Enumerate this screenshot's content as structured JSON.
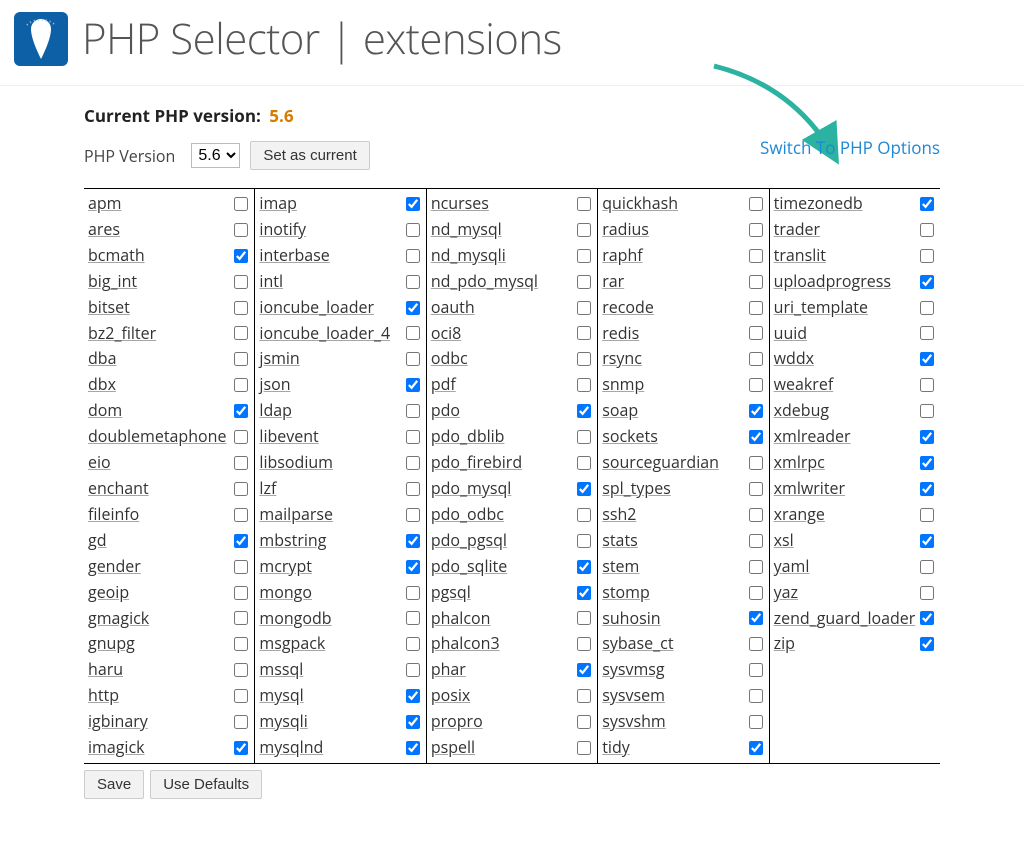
{
  "header": {
    "title": "PHP Selector | extensions"
  },
  "current_version": {
    "label": "Current PHP version:",
    "value": "5.6"
  },
  "selector": {
    "label": "PHP Version",
    "selected": "5.6",
    "set_button": "Set as current"
  },
  "switch_link": "Switch To PHP Options",
  "buttons": {
    "save": "Save",
    "defaults": "Use Defaults"
  },
  "extensions": [
    [
      {
        "name": "apm",
        "checked": false
      },
      {
        "name": "ares",
        "checked": false
      },
      {
        "name": "bcmath",
        "checked": true
      },
      {
        "name": "big_int",
        "checked": false
      },
      {
        "name": "bitset",
        "checked": false
      },
      {
        "name": "bz2_filter",
        "checked": false
      },
      {
        "name": "dba",
        "checked": false
      },
      {
        "name": "dbx",
        "checked": false
      },
      {
        "name": "dom",
        "checked": true
      },
      {
        "name": "doublemetaphone",
        "checked": false
      },
      {
        "name": "eio",
        "checked": false
      },
      {
        "name": "enchant",
        "checked": false
      },
      {
        "name": "fileinfo",
        "checked": false
      },
      {
        "name": "gd",
        "checked": true
      },
      {
        "name": "gender",
        "checked": false
      },
      {
        "name": "geoip",
        "checked": false
      },
      {
        "name": "gmagick",
        "checked": false
      },
      {
        "name": "gnupg",
        "checked": false
      },
      {
        "name": "haru",
        "checked": false
      },
      {
        "name": "http",
        "checked": false
      },
      {
        "name": "igbinary",
        "checked": false
      },
      {
        "name": "imagick",
        "checked": true
      }
    ],
    [
      {
        "name": "imap",
        "checked": true
      },
      {
        "name": "inotify",
        "checked": false
      },
      {
        "name": "interbase",
        "checked": false
      },
      {
        "name": "intl",
        "checked": false
      },
      {
        "name": "ioncube_loader",
        "checked": true
      },
      {
        "name": "ioncube_loader_4",
        "checked": false
      },
      {
        "name": "jsmin",
        "checked": false
      },
      {
        "name": "json",
        "checked": true
      },
      {
        "name": "ldap",
        "checked": false
      },
      {
        "name": "libevent",
        "checked": false
      },
      {
        "name": "libsodium",
        "checked": false
      },
      {
        "name": "lzf",
        "checked": false
      },
      {
        "name": "mailparse",
        "checked": false
      },
      {
        "name": "mbstring",
        "checked": true
      },
      {
        "name": "mcrypt",
        "checked": true
      },
      {
        "name": "mongo",
        "checked": false
      },
      {
        "name": "mongodb",
        "checked": false
      },
      {
        "name": "msgpack",
        "checked": false
      },
      {
        "name": "mssql",
        "checked": false
      },
      {
        "name": "mysql",
        "checked": true
      },
      {
        "name": "mysqli",
        "checked": true
      },
      {
        "name": "mysqlnd",
        "checked": true
      }
    ],
    [
      {
        "name": "ncurses",
        "checked": false
      },
      {
        "name": "nd_mysql",
        "checked": false
      },
      {
        "name": "nd_mysqli",
        "checked": false
      },
      {
        "name": "nd_pdo_mysql",
        "checked": false
      },
      {
        "name": "oauth",
        "checked": false
      },
      {
        "name": "oci8",
        "checked": false
      },
      {
        "name": "odbc",
        "checked": false
      },
      {
        "name": "pdf",
        "checked": false
      },
      {
        "name": "pdo",
        "checked": true
      },
      {
        "name": "pdo_dblib",
        "checked": false
      },
      {
        "name": "pdo_firebird",
        "checked": false
      },
      {
        "name": "pdo_mysql",
        "checked": true
      },
      {
        "name": "pdo_odbc",
        "checked": false
      },
      {
        "name": "pdo_pgsql",
        "checked": false
      },
      {
        "name": "pdo_sqlite",
        "checked": true
      },
      {
        "name": "pgsql",
        "checked": true
      },
      {
        "name": "phalcon",
        "checked": false
      },
      {
        "name": "phalcon3",
        "checked": false
      },
      {
        "name": "phar",
        "checked": true
      },
      {
        "name": "posix",
        "checked": false
      },
      {
        "name": "propro",
        "checked": false
      },
      {
        "name": "pspell",
        "checked": false
      }
    ],
    [
      {
        "name": "quickhash",
        "checked": false
      },
      {
        "name": "radius",
        "checked": false
      },
      {
        "name": "raphf",
        "checked": false
      },
      {
        "name": "rar",
        "checked": false
      },
      {
        "name": "recode",
        "checked": false
      },
      {
        "name": "redis",
        "checked": false
      },
      {
        "name": "rsync",
        "checked": false
      },
      {
        "name": "snmp",
        "checked": false
      },
      {
        "name": "soap",
        "checked": true
      },
      {
        "name": "sockets",
        "checked": true
      },
      {
        "name": "sourceguardian",
        "checked": false
      },
      {
        "name": "spl_types",
        "checked": false
      },
      {
        "name": "ssh2",
        "checked": false
      },
      {
        "name": "stats",
        "checked": false
      },
      {
        "name": "stem",
        "checked": false
      },
      {
        "name": "stomp",
        "checked": false
      },
      {
        "name": "suhosin",
        "checked": true
      },
      {
        "name": "sybase_ct",
        "checked": false
      },
      {
        "name": "sysvmsg",
        "checked": false
      },
      {
        "name": "sysvsem",
        "checked": false
      },
      {
        "name": "sysvshm",
        "checked": false
      },
      {
        "name": "tidy",
        "checked": true
      }
    ],
    [
      {
        "name": "timezonedb",
        "checked": true
      },
      {
        "name": "trader",
        "checked": false
      },
      {
        "name": "translit",
        "checked": false
      },
      {
        "name": "uploadprogress",
        "checked": true
      },
      {
        "name": "uri_template",
        "checked": false
      },
      {
        "name": "uuid",
        "checked": false
      },
      {
        "name": "wddx",
        "checked": true
      },
      {
        "name": "weakref",
        "checked": false
      },
      {
        "name": "xdebug",
        "checked": false
      },
      {
        "name": "xmlreader",
        "checked": true
      },
      {
        "name": "xmlrpc",
        "checked": true
      },
      {
        "name": "xmlwriter",
        "checked": true
      },
      {
        "name": "xrange",
        "checked": false
      },
      {
        "name": "xsl",
        "checked": true
      },
      {
        "name": "yaml",
        "checked": false
      },
      {
        "name": "yaz",
        "checked": false
      },
      {
        "name": "zend_guard_loader",
        "checked": true
      },
      {
        "name": "zip",
        "checked": true
      }
    ]
  ]
}
